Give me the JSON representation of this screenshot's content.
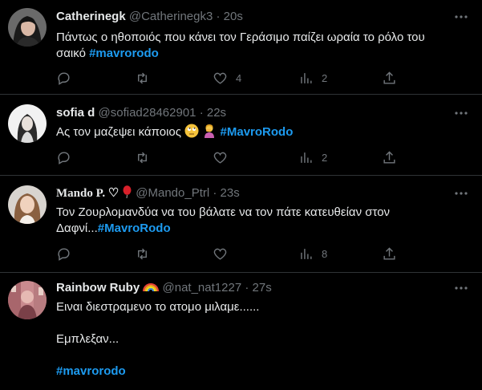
{
  "tweets": [
    {
      "name": "Catherinegk",
      "handle": "@Catherinegk3",
      "separator": "·",
      "time": "20s",
      "text_line1": "Πάντως ο ηθοποιός που κάνει τον Γεράσιμο παίζει ωραία το ρόλο του",
      "text_line2": "σαικό",
      "hashtag": "#mavrorodo",
      "likes": "4",
      "views": "2"
    },
    {
      "name": "sofia d",
      "handle": "@sofiad28462901",
      "separator": "·",
      "time": "22s",
      "text_line1": "Ας τον μαζεψει κάποιος",
      "hashtag": "#MavroRodo",
      "views": "2"
    },
    {
      "name": "Mando P.",
      "name_suffix": "♡",
      "handle": "@Mando_Ptrl",
      "separator": "·",
      "time": "23s",
      "text_line1": "Τον Ζουρλομανδύα να του βάλατε να τον πάτε κατευθείαν στον",
      "text_line2": "Δαφνί...",
      "hashtag": "#MavroRodo",
      "views": "8"
    },
    {
      "name": "Rainbow Ruby",
      "handle": "@nat_nat1227",
      "separator": "·",
      "time": "27s",
      "text_line1": "Ειναι διεστραμενο το ατομο μιλαμε......",
      "text_line2": "Εμπλεξαν...",
      "hashtag": "#mavrorodo"
    }
  ],
  "icons": {
    "more": "more-dots-icon",
    "reply": "reply-icon",
    "retweet": "retweet-icon",
    "like": "like-icon",
    "views": "views-icon",
    "share": "share-icon"
  },
  "colors": {
    "background": "#000000",
    "text": "#e7e9ea",
    "muted": "#71767b",
    "accent": "#1d9bf0",
    "divider": "#2f3336"
  }
}
